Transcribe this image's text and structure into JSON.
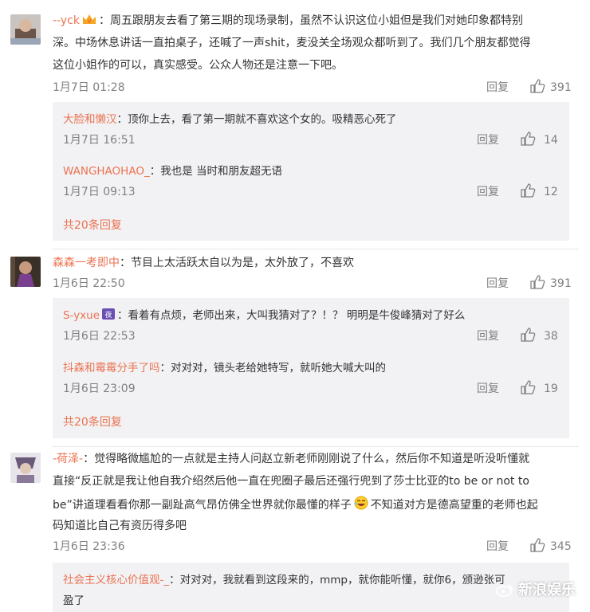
{
  "comments": [
    {
      "user": "--yck",
      "text_lines": [
        "：周五跟朋友去看了第三期的现场录制，虽然不认识这位小姐但是我们对她印象都特别",
        "深。中场休息讲话一直拍桌子，还喊了一声shit，麦没关全场观众都听到了。我们几个朋友都觉得",
        "这位小姐作的可以，真实感受。公众人物还是注意一下吧。"
      ],
      "time": "1月7日 01:28",
      "reply_label": "回复",
      "likes": "391",
      "replies": [
        {
          "user": "大脸和懒汉",
          "text": "：顶你上去，看了第一期就不喜欢这个女的。吸精恶心死了",
          "time": "1月7日 16:51",
          "reply_label": "回复",
          "likes": "14"
        },
        {
          "user": "WANGHAOHAO_",
          "text": "：我也是 当时和朋友超无语",
          "time": "1月7日 09:13",
          "reply_label": "回复",
          "likes": "12"
        }
      ],
      "more": "共20条回复"
    },
    {
      "user": "森森一考即中",
      "text_lines": [
        "：节目上太活跃太自以为是，太外放了，不喜欢"
      ],
      "time": "1月6日 22:50",
      "reply_label": "回复",
      "likes": "391",
      "replies": [
        {
          "user": "S-yxue",
          "text": "：看着有点烦，老师出来，大叫我猜对了？！？ 明明是牛俊峰猜对了好么",
          "time": "1月6日 22:53",
          "reply_label": "回复",
          "likes": "38"
        },
        {
          "user": "抖森和霉霉分手了吗",
          "text": "：对对对，镜头老给她特写，就听她大喊大叫的",
          "time": "1月6日 23:09",
          "reply_label": "回复",
          "likes": "19"
        }
      ],
      "more": "共20条回复"
    },
    {
      "user": "-荷泽-",
      "text_lines": [
        "：觉得略微尴尬的一点就是主持人问赵立新老师刚刚说了什么，然后你不知道是听没听懂就",
        "直接“反正就是我让他自我介绍然后他一直在兜圈子最后还强行兜到了莎士比亚的to be or not to",
        "be”讲道理看看你那一副趾高气昂仿佛全世界就你最懂的样子",
        "码知道比自己有资历得多吧"
      ],
      "line3_tail": "不知道对方是德高望重的老师也起",
      "time": "1月6日 23:36",
      "reply_label": "回复",
      "likes": "345",
      "replies": [
        {
          "user": "社会主义核心价值观-_",
          "text": "：对对对，我就看到这段来的，mmp，就你能听懂，就你6，颁逊张可",
          "text2": "盈了"
        }
      ]
    }
  ],
  "watermark": "新浪娱乐",
  "colors": {
    "username": "#eb7350",
    "meta": "#808080",
    "reply_bg": "#f2f2f5",
    "text": "#333333"
  }
}
